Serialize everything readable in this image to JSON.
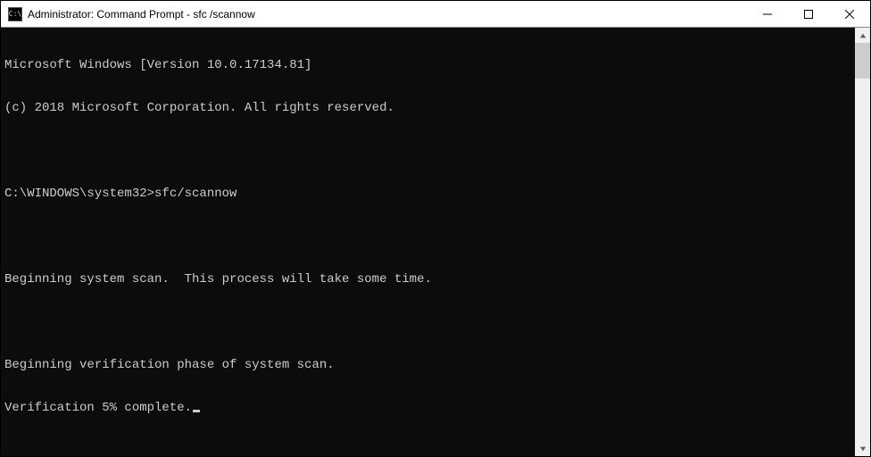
{
  "titlebar": {
    "icon_text": "C:\\",
    "title": "Administrator: Command Prompt - sfc  /scannow"
  },
  "terminal": {
    "lines": [
      "Microsoft Windows [Version 10.0.17134.81]",
      "(c) 2018 Microsoft Corporation. All rights reserved.",
      "",
      "C:\\WINDOWS\\system32>sfc/scannow",
      "",
      "Beginning system scan.  This process will take some time.",
      "",
      "Beginning verification phase of system scan.",
      "Verification 5% complete."
    ]
  }
}
